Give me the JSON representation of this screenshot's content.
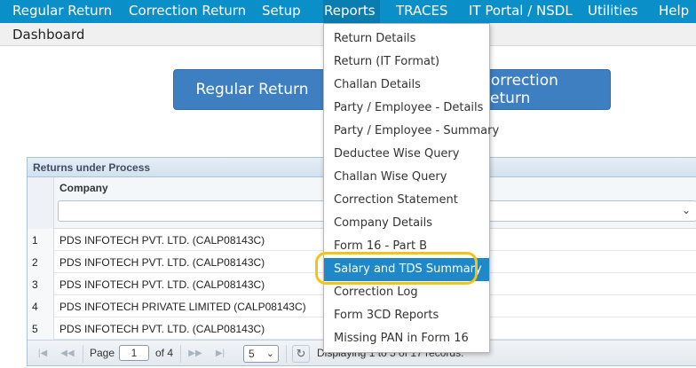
{
  "menubar": {
    "items": [
      "Regular Return",
      "Correction Return",
      "Setup",
      "Reports",
      "TRACES",
      "IT Portal / NSDL",
      "Utilities",
      "Help"
    ]
  },
  "breadcrumb": {
    "label": "Dashboard"
  },
  "buttons": {
    "regular_return": "Regular Return",
    "correction_return": "Correction Return"
  },
  "grid": {
    "title": "Returns under Process",
    "column_company": "Company",
    "rows": [
      {
        "num": "1",
        "company": "PDS INFOTECH PVT. LTD. (CALP08143C)"
      },
      {
        "num": "2",
        "company": "PDS INFOTECH PVT. LTD. (CALP08143C)"
      },
      {
        "num": "3",
        "company": "PDS INFOTECH PVT. LTD. (CALP08143C)"
      },
      {
        "num": "4",
        "company": "PDS INFOTECH PRIVATE LIMITED (CALP08143C)"
      },
      {
        "num": "5",
        "company": "PDS INFOTECH PVT. LTD. (CALP08143C)"
      }
    ],
    "pager": {
      "page_label": "Page",
      "page_value": "1",
      "of_label": "of 4",
      "page_size": "5",
      "status": "Displaying 1 to 5 of 17 records."
    }
  },
  "reports_menu": {
    "items": [
      "Return Details",
      "Return (IT Format)",
      "Challan Details",
      "Party / Employee - Details",
      "Party / Employee - Summary",
      "Deductee Wise Query",
      "Challan Wise Query",
      "Correction Statement",
      "Company Details",
      "Form 16 - Part B",
      "Salary and TDS Summary",
      "Correction Log",
      "Form 3CD Reports",
      "Missing PAN in Form 16"
    ],
    "highlighted_index": 10
  },
  "colors": {
    "menubar_bg": "#0b8fc9",
    "button_bg": "#3d7fc0",
    "highlight_item": "#1e88c8",
    "highlight_ring": "#f2c416"
  }
}
